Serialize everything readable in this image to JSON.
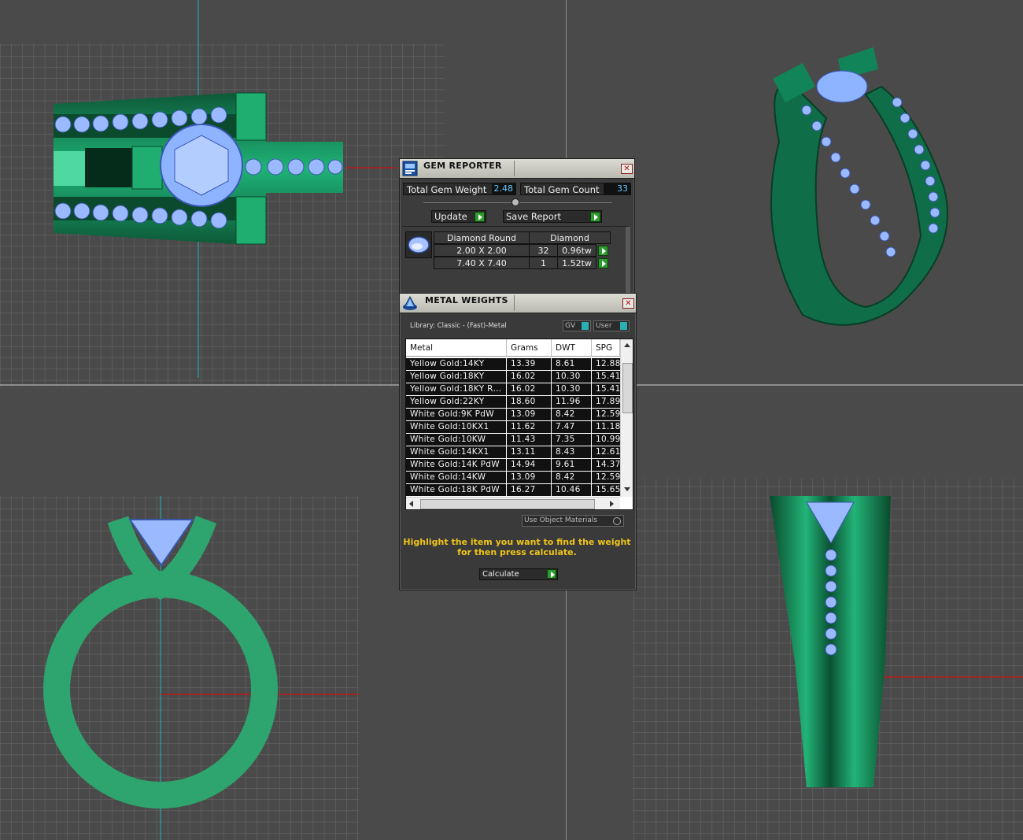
{
  "gem_reporter": {
    "title": "GEM REPORTER",
    "icon": "gem-reporter-icon",
    "total_gem_weight_label": "Total Gem Weight",
    "total_gem_weight": "2.48",
    "total_gem_count_label": "Total Gem Count",
    "total_gem_count": "33",
    "update_label": "Update",
    "save_report_label": "Save Report",
    "gem_icon": "oval-gem-icon",
    "columns": [
      "Diamond Round",
      "Diamond"
    ],
    "rows": [
      {
        "size": "2.00 X 2.00",
        "count": "32",
        "weight": "0.96tw"
      },
      {
        "size": "7.40 X 7.40",
        "count": "1",
        "weight": "1.52tw"
      }
    ]
  },
  "metal_weights": {
    "title": "METAL WEIGHTS",
    "icon": "metal-weights-icon",
    "library_label": "Library: Classic - (Fast)-Metal",
    "gv_label": "GV",
    "user_label": "User",
    "columns": [
      "Metal",
      "Grams",
      "DWT",
      "SPG"
    ],
    "rows": [
      {
        "metal": "Yellow Gold:14KY",
        "grams": "13.39",
        "dwt": "8.61",
        "spg": "12.88"
      },
      {
        "metal": "Yellow Gold:18KY",
        "grams": "16.02",
        "dwt": "10.30",
        "spg": "15.41"
      },
      {
        "metal": "Yellow Gold:18KY R…",
        "grams": "16.02",
        "dwt": "10.30",
        "spg": "15.41"
      },
      {
        "metal": "Yellow Gold:22KY",
        "grams": "18.60",
        "dwt": "11.96",
        "spg": "17.89"
      },
      {
        "metal": "White Gold:9K PdW",
        "grams": "13.09",
        "dwt": "8.42",
        "spg": "12.59"
      },
      {
        "metal": "White Gold:10KX1",
        "grams": "11.62",
        "dwt": "7.47",
        "spg": "11.18"
      },
      {
        "metal": "White Gold:10KW",
        "grams": "11.43",
        "dwt": "7.35",
        "spg": "10.99"
      },
      {
        "metal": "White Gold:14KX1",
        "grams": "13.11",
        "dwt": "8.43",
        "spg": "12.61"
      },
      {
        "metal": "White Gold:14K PdW",
        "grams": "14.94",
        "dwt": "9.61",
        "spg": "14.37"
      },
      {
        "metal": "White Gold:14KW",
        "grams": "13.09",
        "dwt": "8.42",
        "spg": "12.59"
      },
      {
        "metal": "White Gold:18K PdW",
        "grams": "16.27",
        "dwt": "10.46",
        "spg": "15.65"
      }
    ],
    "use_object_materials_label": "Use Object Materials",
    "hint_line1": "Highlight the item you want to find the weight",
    "hint_line2": "for then press calculate.",
    "calculate_label": "Calculate"
  },
  "colors": {
    "metal_green": "#1b8a5a",
    "gem_blue": "#8fb4ff",
    "viewport_bg": "#4a4a4a",
    "grid_line": "#6b6b6b",
    "axis_cyan": "#19b5c2",
    "axis_red": "#b51b1b",
    "hint_yellow": "#f0c419"
  }
}
